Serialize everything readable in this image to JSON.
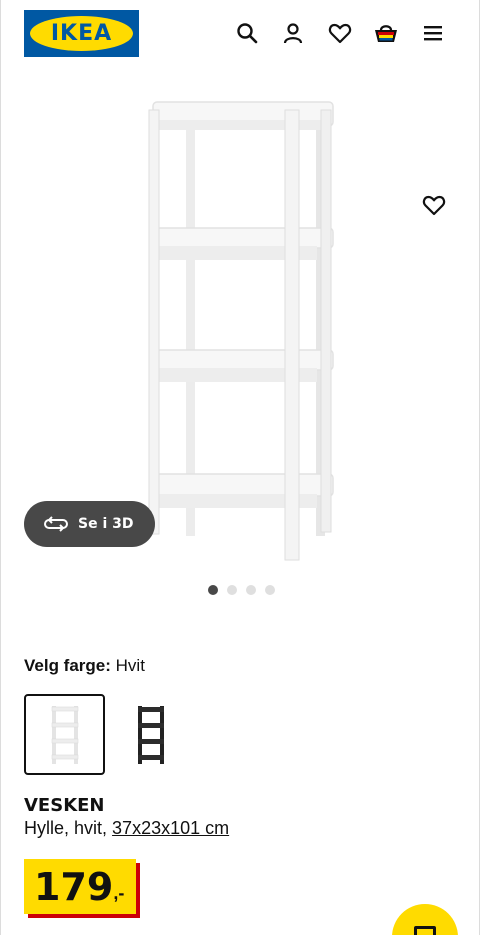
{
  "header": {
    "logo_text": "IKEA",
    "icons": [
      "search-icon",
      "account-icon",
      "favourites-icon",
      "shopping-bag-icon",
      "menu-icon"
    ]
  },
  "gallery": {
    "view_3d_label": "Se i 3D",
    "slide_count": 4,
    "active_slide": 1
  },
  "color_selector": {
    "label": "Velg farge:",
    "selected_value": "Hvit",
    "options": [
      "white",
      "black"
    ]
  },
  "product": {
    "name": "VESKEN",
    "description": "Hylle, hvit,",
    "dimensions": "37x23x101 cm"
  },
  "price": {
    "amount": "179",
    "suffix": ",-"
  },
  "colors": {
    "brand_blue": "#0058a3",
    "brand_yellow": "#ffdb00",
    "price_shadow_red": "#cc0008",
    "button_dark": "#484848"
  }
}
